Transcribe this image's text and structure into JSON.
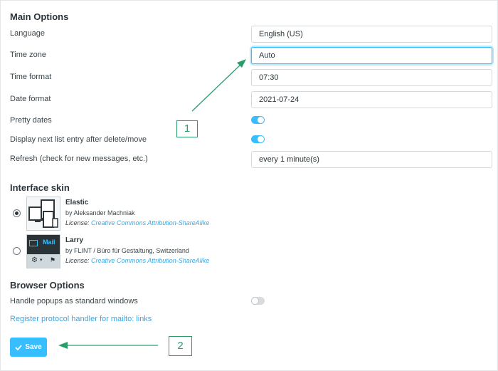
{
  "main_options": {
    "title": "Main Options",
    "language": {
      "label": "Language",
      "value": "English (US)"
    },
    "time_zone": {
      "label": "Time zone",
      "value": "Auto"
    },
    "time_format": {
      "label": "Time format",
      "value": "07:30"
    },
    "date_format": {
      "label": "Date format",
      "value": "2021-07-24"
    },
    "pretty_dates": {
      "label": "Pretty dates",
      "enabled": true
    },
    "next_entry": {
      "label": "Display next list entry after delete/move",
      "enabled": true
    },
    "refresh": {
      "label": "Refresh (check for new messages, etc.)",
      "value": "every 1 minute(s)"
    }
  },
  "interface_skin": {
    "title": "Interface skin",
    "skins": [
      {
        "name": "Elastic",
        "author": "by Aleksander Machniak",
        "license_prefix": "License:",
        "license": "Creative Commons Attribution-ShareAlike",
        "selected": true
      },
      {
        "name": "Larry",
        "author": "by FLINT / Büro für Gestaltung, Switzerland",
        "license_prefix": "License:",
        "license": "Creative Commons Attribution-ShareAlike",
        "selected": false,
        "thumb_text": "Mail"
      }
    ]
  },
  "browser_options": {
    "title": "Browser Options",
    "popups": {
      "label": "Handle popups as standard windows",
      "enabled": false
    },
    "protocol_link": "Register protocol handler for mailto: links"
  },
  "save_button": {
    "label": "Save",
    "icon": "check-icon"
  },
  "callouts": [
    "1",
    "2"
  ],
  "colors": {
    "accent": "#37beff",
    "annotation": "#2a9d6b",
    "link": "#37a8e5"
  }
}
